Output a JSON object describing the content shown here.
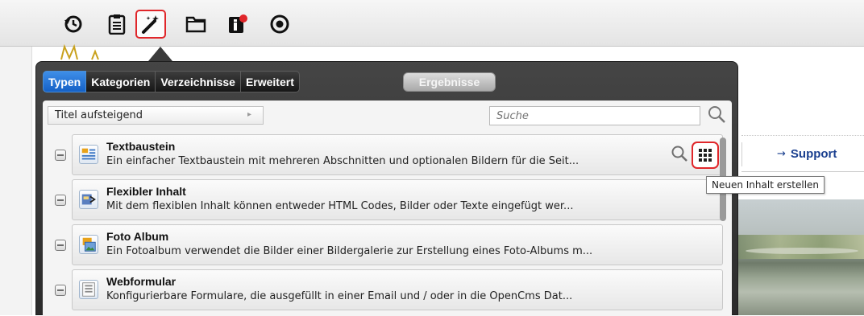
{
  "toolbar": {
    "buttons": [
      {
        "icon": "history-icon",
        "glyph": "⟲"
      },
      {
        "icon": "clipboard-icon",
        "glyph": "📋"
      },
      {
        "icon": "magic-wand-icon",
        "glyph": "✨"
      },
      {
        "icon": "folder-icon",
        "glyph": "🗀"
      },
      {
        "icon": "info-icon",
        "glyph": "ℹ"
      },
      {
        "icon": "target-icon",
        "glyph": "◉"
      }
    ]
  },
  "background": {
    "nav_link_arrow": "→",
    "nav_link": "Support"
  },
  "dialog": {
    "tabs": [
      {
        "label": "Typen",
        "active": true
      },
      {
        "label": "Kategorien",
        "active": false
      },
      {
        "label": "Verzeichnisse",
        "active": false
      },
      {
        "label": "Erweitert",
        "active": false
      }
    ],
    "results_button": "Ergebnisse",
    "sort": {
      "value": "Titel aufsteigend"
    },
    "search": {
      "placeholder": "Suche"
    },
    "items": [
      {
        "title": "Textbaustein",
        "description": "Ein einfacher Textbaustein mit mehreren Abschnitten und optionalen Bildern für die Seit...",
        "icon": "text-block-icon"
      },
      {
        "title": "Flexibler Inhalt",
        "description": "Mit dem flexiblen Inhalt können entweder HTML Codes, Bilder oder Texte eingefügt wer...",
        "icon": "flexible-content-icon"
      },
      {
        "title": "Foto Album",
        "description": "Ein Fotoalbum verwendet die Bilder einer Bildergalerie zur Erstellung eines Foto-Albums m...",
        "icon": "photo-album-icon"
      },
      {
        "title": "Webformular",
        "description": "Konfigurierbare Formulare, die ausgefüllt in einer Email und / oder in die OpenCms Dat...",
        "icon": "web-form-icon"
      }
    ],
    "tooltip": "Neuen Inhalt erstellen"
  },
  "colors": {
    "accent_red": "#e0262a",
    "active_tab_blue": "#1561c6",
    "link_blue": "#1a3f8f"
  }
}
